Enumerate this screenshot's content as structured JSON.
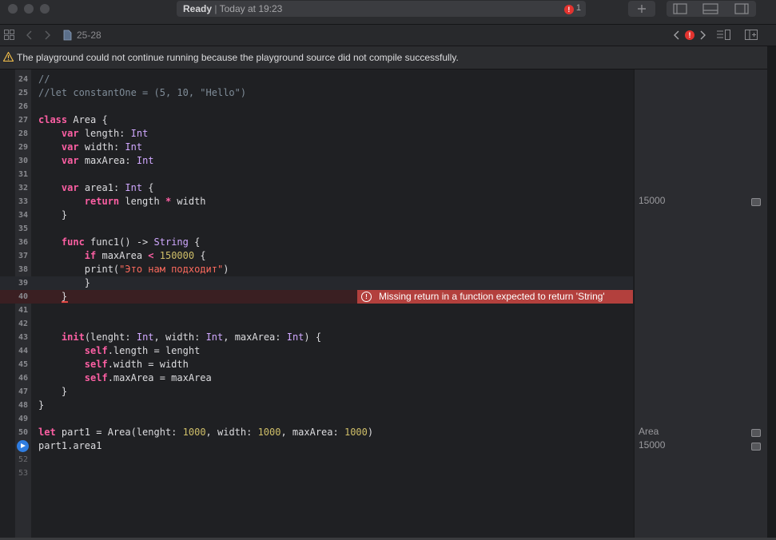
{
  "window": {
    "status_title": "Ready",
    "status_separator": "|",
    "status_time": "Today at 19:23",
    "error_count": "1",
    "error_icon": "!"
  },
  "nav": {
    "breadcrumb": "25-28",
    "issue_icon": "!"
  },
  "banner": {
    "message": "The playground could not continue running because the playground source did not compile successfully."
  },
  "editor": {
    "error_message": "Missing return in a function expected to return 'String'",
    "error_icon": "!",
    "lines": [
      {
        "num": "24",
        "text": "//"
      },
      {
        "num": "25",
        "text": "//let constantOne = (5, 10, \"Hello\")"
      },
      {
        "num": "26",
        "text": ""
      },
      {
        "num": "27",
        "text": "class Area {"
      },
      {
        "num": "28",
        "text": "    var length: Int"
      },
      {
        "num": "29",
        "text": "    var width: Int"
      },
      {
        "num": "30",
        "text": "    var maxArea: Int"
      },
      {
        "num": "31",
        "text": ""
      },
      {
        "num": "32",
        "text": "    var area1: Int {"
      },
      {
        "num": "33",
        "text": "        return length * width"
      },
      {
        "num": "34",
        "text": "    }"
      },
      {
        "num": "35",
        "text": ""
      },
      {
        "num": "36",
        "text": "    func func1() -> String {"
      },
      {
        "num": "37",
        "text": "        if maxArea < 150000 {"
      },
      {
        "num": "38",
        "text": "        print(\"Это нам подходит\")"
      },
      {
        "num": "39",
        "text": "        }"
      },
      {
        "num": "40",
        "text": "    }"
      },
      {
        "num": "41",
        "text": ""
      },
      {
        "num": "42",
        "text": ""
      },
      {
        "num": "43",
        "text": "    init(lenght: Int, width: Int, maxArea: Int) {"
      },
      {
        "num": "44",
        "text": "        self.length = lenght"
      },
      {
        "num": "45",
        "text": "        self.width = width"
      },
      {
        "num": "46",
        "text": "        self.maxArea = maxArea"
      },
      {
        "num": "47",
        "text": "    }"
      },
      {
        "num": "48",
        "text": "}"
      },
      {
        "num": "49",
        "text": ""
      },
      {
        "num": "50",
        "text": "let part1 = Area(lenght: 1000, width: 1000, maxArea: 1000)"
      },
      {
        "num": "",
        "text": "part1.area1"
      },
      {
        "num": "52",
        "text": ""
      },
      {
        "num": "53",
        "text": ""
      }
    ]
  },
  "results": {
    "line33": "15000",
    "line50": "Area",
    "line51": "15000"
  }
}
